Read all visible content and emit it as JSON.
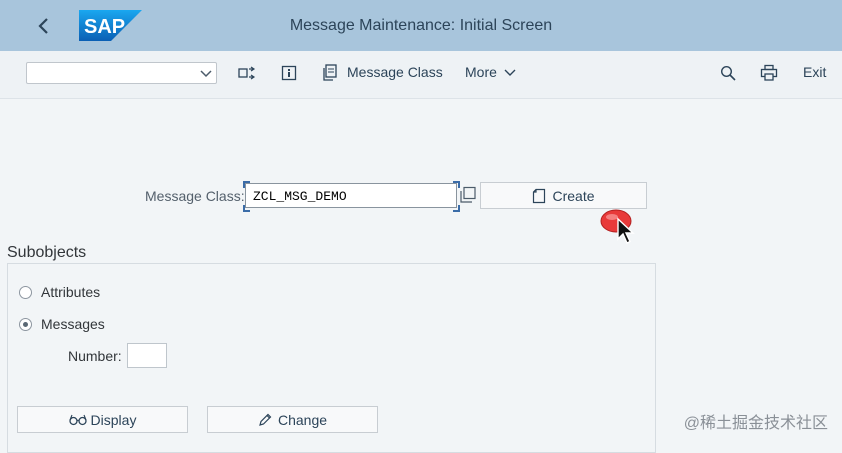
{
  "header": {
    "title": "Message Maintenance: Initial Screen",
    "logo_text": "SAP",
    "back_icon": "chevron-left-icon"
  },
  "toolbar": {
    "command_field_value": "",
    "command_field_icon": "chevron-down-icon",
    "object_list_icon": "object-list-icon",
    "info_icon": "info-icon",
    "message_class_label": "Message Class",
    "message_class_icon": "copy-icon",
    "more_label": "More",
    "more_icon": "chevron-down-icon",
    "search_icon": "search-icon",
    "print_icon": "printer-icon",
    "exit_label": "Exit"
  },
  "form": {
    "message_class_label": "Message Class:",
    "message_class_value": "ZCL_MSG_DEMO",
    "value_help_icon": "value-help-icon",
    "create_label": "Create",
    "create_icon": "document-icon"
  },
  "subobjects": {
    "title": "Subobjects",
    "options": [
      {
        "label": "Attributes",
        "selected": false
      },
      {
        "label": "Messages",
        "selected": true
      }
    ],
    "number_label": "Number:",
    "number_value": "",
    "display_label": "Display",
    "display_icon": "glasses-icon",
    "change_label": "Change",
    "change_icon": "pencil-icon"
  },
  "watermark": "@稀土掘金技术社区",
  "colors": {
    "header_bg": "#a8c5dc",
    "toolbar_bg": "#eef2f5",
    "page_bg": "#f2f5f7",
    "text_dark": "#2c4459",
    "sap_blue": "#0a6ed1",
    "pointer_red": "#e83a3a"
  }
}
